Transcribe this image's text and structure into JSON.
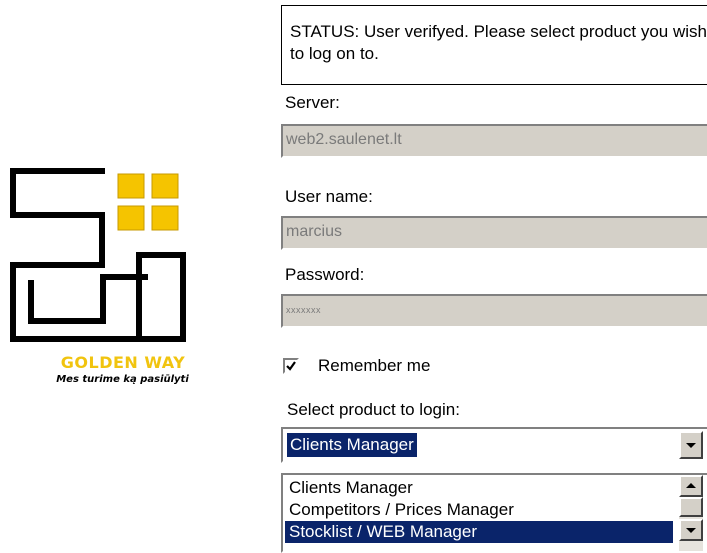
{
  "logo": {
    "brand": "GOLDEN WAY",
    "tagline": "Mes turime ką pasiūlyti",
    "accent_color": "#f5c400"
  },
  "status": {
    "text": "STATUS: User verifyed. Please select product you wish to log on to."
  },
  "server": {
    "label": "Server:",
    "value": "web2.saulenet.lt"
  },
  "username": {
    "label": "User name:",
    "value": "marcius"
  },
  "password": {
    "label": "Password:",
    "value": "xxxxxxx"
  },
  "remember": {
    "label": "Remember me",
    "checked": true
  },
  "product": {
    "label": "Select product to login:",
    "selected": "Clients Manager",
    "options": [
      "Clients Manager",
      "Competitors / Prices Manager",
      "Stocklist / WEB Manager"
    ],
    "highlighted_option": "Stocklist / WEB Manager"
  },
  "colors": {
    "selection": "#0a246a",
    "field_bg": "#d4d0c8",
    "disabled_text": "#7a7a7a"
  }
}
